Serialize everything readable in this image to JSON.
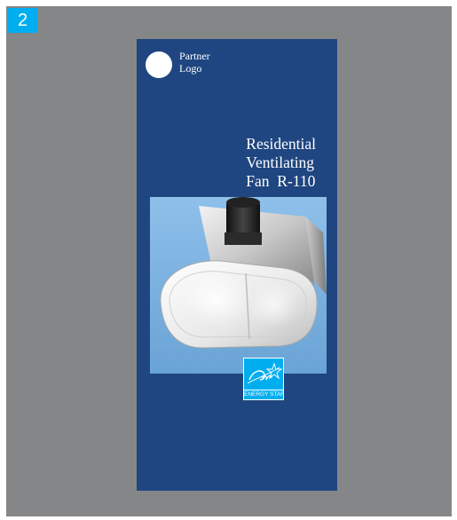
{
  "page": {
    "number": "2"
  },
  "brochure": {
    "partner_logo": {
      "line1": "Partner",
      "line2": "Logo"
    },
    "title": {
      "line1": "Residential",
      "line2": "Ventilating",
      "line3": "Fan  R-110"
    },
    "product_image": "residential ventilating fan photo",
    "badge": {
      "label": "ENERGY STAR",
      "script_text": "energy"
    }
  },
  "colors": {
    "brochure_background": "#1f4680",
    "surround_background": "#858688",
    "page_badge": "#00aeef",
    "photo_background": "#7fb3df",
    "energy_star_blue": "#00aeef"
  },
  "icons": {
    "partner_logo": "white-circle-icon",
    "energy_star": "energy-star-logo-icon"
  }
}
